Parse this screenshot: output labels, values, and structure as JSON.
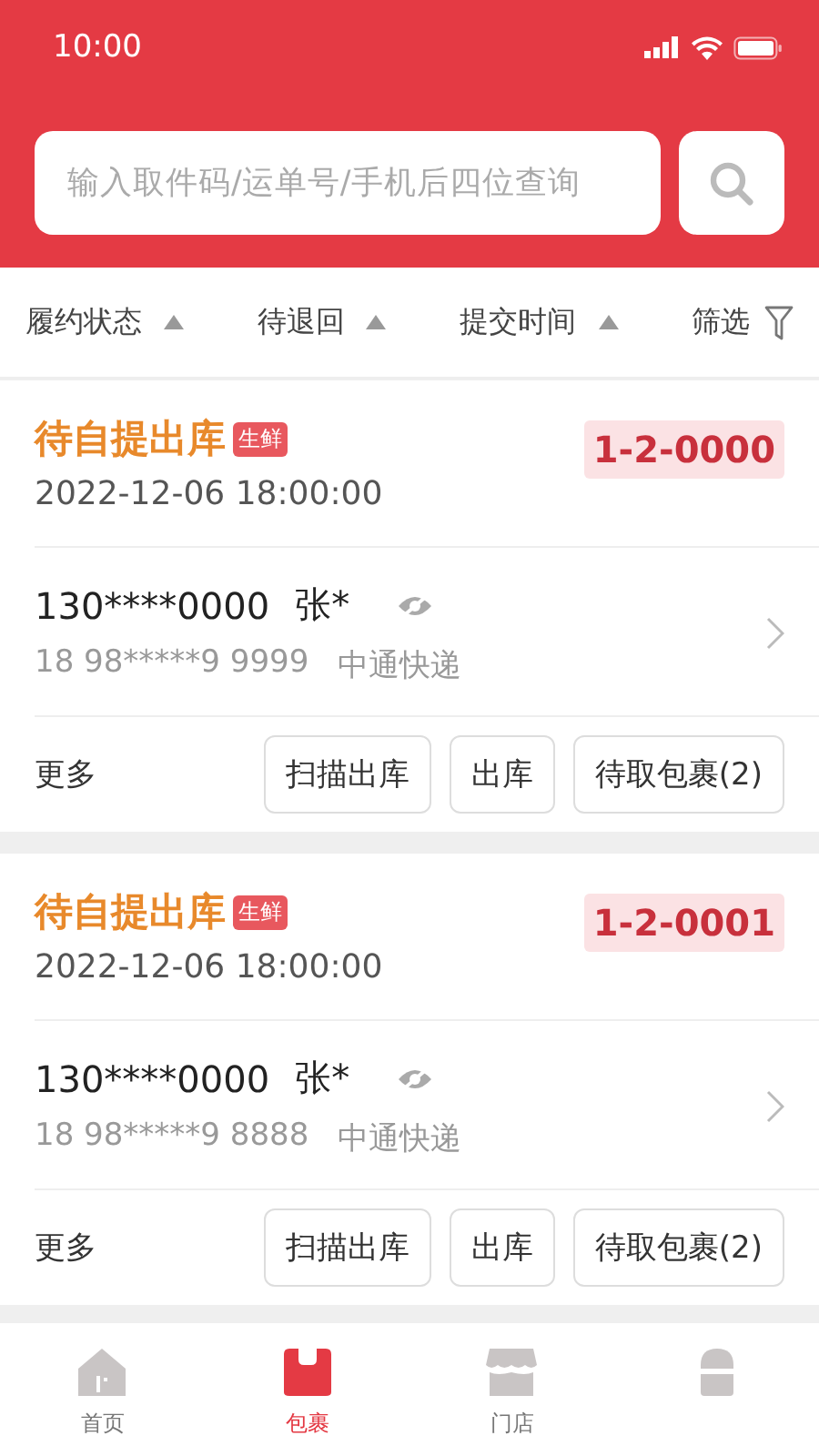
{
  "status_bar": {
    "time": "10:00"
  },
  "search": {
    "placeholder": "输入取件码/运单号/手机后四位查询"
  },
  "sort_bar": [
    {
      "label": "履约状态",
      "kind": "sort"
    },
    {
      "label": "待退回",
      "kind": "sort"
    },
    {
      "label": "提交时间",
      "kind": "sort"
    },
    {
      "label": "筛选",
      "kind": "filter"
    }
  ],
  "orders": [
    {
      "status": "待自提出库",
      "tag": "生鲜",
      "time": "2022-12-06 18:00:00",
      "code": "1-2-0000",
      "phone": "130****0000",
      "name": "张*",
      "tracking": "18 98*****9 9999",
      "courier": "中通快递",
      "more": "更多",
      "actions": [
        "扫描出库",
        "出库",
        "待取包裹(2)"
      ]
    },
    {
      "status": "待自提出库",
      "tag": "生鲜",
      "time": "2022-12-06 18:00:00",
      "code": "1-2-0001",
      "phone": "130****0000",
      "name": "张*",
      "tracking": "18 98*****9 8888",
      "courier": "中通快递",
      "more": "更多",
      "actions": [
        "扫描出库",
        "出库",
        "待取包裹(2)"
      ]
    }
  ],
  "tab_bar": [
    {
      "label": "首页",
      "selected": false
    },
    {
      "label": "包裹",
      "selected": true
    },
    {
      "label": "门店",
      "selected": false
    },
    {
      "selected": false
    }
  ]
}
